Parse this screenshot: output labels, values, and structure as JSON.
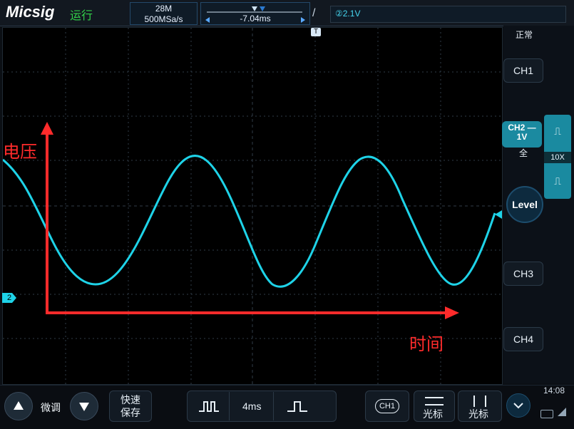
{
  "app": {
    "brand": "Micsig",
    "run_state": "运行"
  },
  "top": {
    "memory": "28M",
    "sample_rate": "500MSa/s",
    "time_offset": "-7.04ms",
    "trigger_slope_symbol": "/",
    "trigger_level": "②2.1V"
  },
  "right": {
    "status": "正常",
    "ch1": "CH1",
    "ch2_top": "CH2",
    "ch2_bottom": "1V",
    "ch2_coupling_symbol": "—",
    "ch2_bandwidth": "全",
    "probe_factor": "10X",
    "level": "Level",
    "ch3": "CH3",
    "ch4": "CH4"
  },
  "bottom": {
    "fine_tune": "微调",
    "quick_save_line1": "快速",
    "quick_save_line2": "保存",
    "time_per_div": "4ms",
    "cursor_label1": "光标",
    "cursor_label2": "光标",
    "ch1_badge": "CH1",
    "clock": "14:08"
  },
  "annotations": {
    "y_label": "电压",
    "x_label": "时间"
  },
  "colors": {
    "trace": "#1ed3e8",
    "annotation": "#ff2b2b"
  }
}
